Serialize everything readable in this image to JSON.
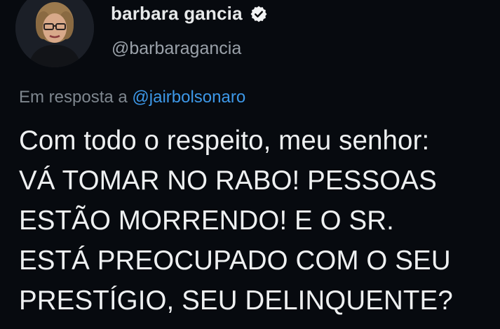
{
  "author": {
    "display_name": "barbara gancia",
    "handle": "@barbaragancia",
    "verified": true
  },
  "reply": {
    "prefix": "Em resposta a",
    "mention": "@jairbolsonaro"
  },
  "tweet": {
    "lines": [
      "Com todo o respeito, meu senhor:",
      "VÁ TOMAR NO RABO! PESSOAS",
      "ESTÃO MORRENDO! E O SR.",
      "ESTÁ PREOCUPADO COM O SEU",
      "PRESTÍGIO, SEU DELINQUENTE?"
    ]
  },
  "colors": {
    "background": "#070a0f",
    "text": "#eef0f1",
    "secondary": "#7e868e",
    "link": "#3d98e8"
  },
  "icons": {
    "verified": "verified-badge-icon",
    "avatar": "profile-photo"
  }
}
